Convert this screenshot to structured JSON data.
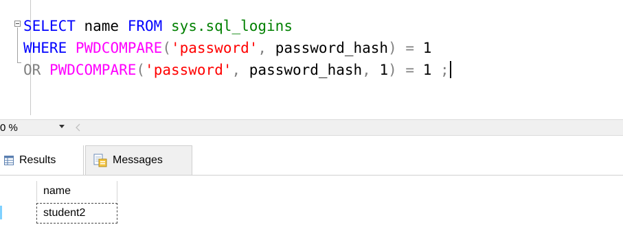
{
  "editor": {
    "lines": [
      {
        "tokens": [
          {
            "text": "SELECT",
            "kind": "kw"
          },
          {
            "text": " name ",
            "kind": "plain"
          },
          {
            "text": "FROM",
            "kind": "kw"
          },
          {
            "text": " ",
            "kind": "plain"
          },
          {
            "text": "sys.sql_logins",
            "kind": "sys"
          }
        ]
      },
      {
        "tokens": [
          {
            "text": "WHERE",
            "kind": "kw"
          },
          {
            "text": " ",
            "kind": "plain"
          },
          {
            "text": "PWDCOMPARE",
            "kind": "fn"
          },
          {
            "text": "(",
            "kind": "gr"
          },
          {
            "text": "'password'",
            "kind": "str"
          },
          {
            "text": ",",
            "kind": "gr"
          },
          {
            "text": " password_hash",
            "kind": "plain"
          },
          {
            "text": ")",
            "kind": "gr"
          },
          {
            "text": " ",
            "kind": "plain"
          },
          {
            "text": "=",
            "kind": "gr"
          },
          {
            "text": " 1",
            "kind": "plain"
          }
        ]
      },
      {
        "tokens": [
          {
            "text": "OR",
            "kind": "gr"
          },
          {
            "text": " ",
            "kind": "plain"
          },
          {
            "text": "PWDCOMPARE",
            "kind": "fn"
          },
          {
            "text": "(",
            "kind": "gr"
          },
          {
            "text": "'password'",
            "kind": "str"
          },
          {
            "text": ",",
            "kind": "gr"
          },
          {
            "text": " password_hash",
            "kind": "plain"
          },
          {
            "text": ",",
            "kind": "gr"
          },
          {
            "text": " 1",
            "kind": "plain"
          },
          {
            "text": ")",
            "kind": "gr"
          },
          {
            "text": " ",
            "kind": "plain"
          },
          {
            "text": "=",
            "kind": "gr"
          },
          {
            "text": " 1 ",
            "kind": "plain"
          },
          {
            "text": ";",
            "kind": "gr"
          }
        ]
      }
    ]
  },
  "zoom": {
    "value": "0 %"
  },
  "results_tabs": {
    "results_label": "Results",
    "messages_label": "Messages"
  },
  "results_grid": {
    "columns": [
      "name"
    ],
    "rows": [
      [
        "student2"
      ]
    ]
  },
  "icons": {
    "collapse": "collapse-minus-icon",
    "zoom_dropdown": "chevron-down-icon",
    "scroll_left": "chevron-left-icon",
    "results": "grid-icon",
    "messages": "messages-icon"
  },
  "colors": {
    "keyword": "#0000ff",
    "function": "#ff00ff",
    "system_object": "#008000",
    "string": "#ff0000",
    "operator": "#808080"
  }
}
